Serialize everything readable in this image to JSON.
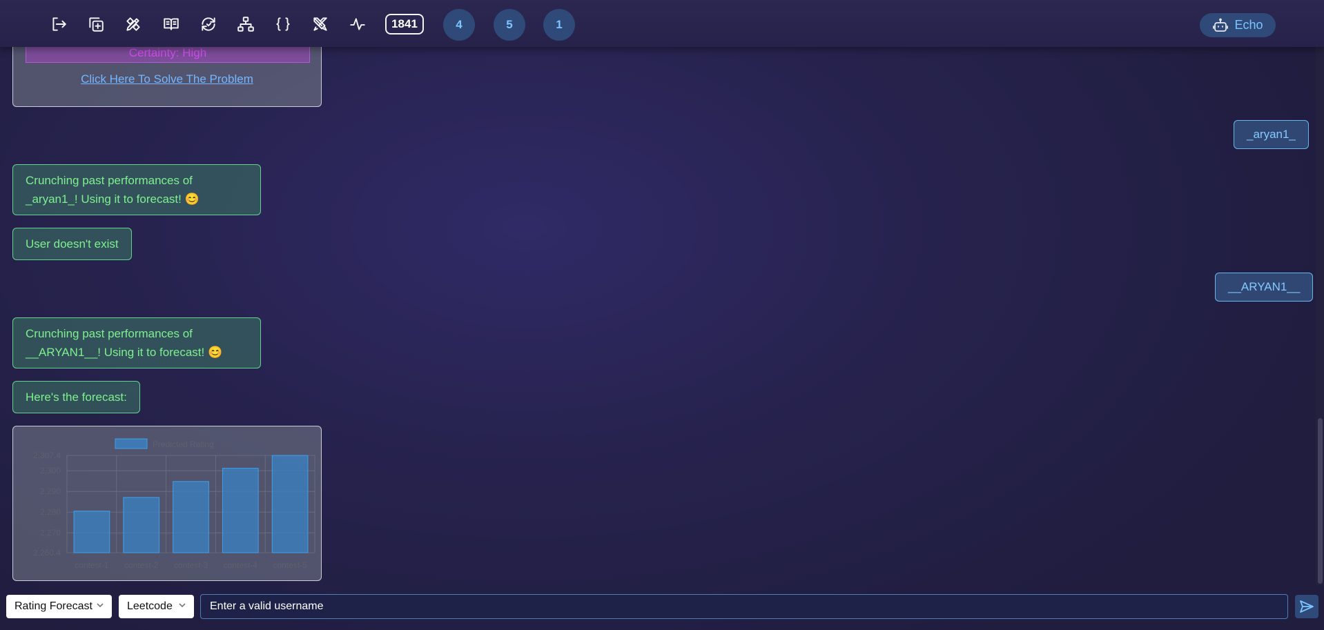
{
  "toolbar": {
    "icons": [
      "logout-icon",
      "copy-add-icon",
      "edit-ruler-icon",
      "book-open-icon",
      "refresh-icon",
      "sitemap-icon",
      "braces-icon",
      "swords-icon",
      "activity-icon"
    ],
    "count": "1841",
    "badges": [
      "4",
      "5",
      "1"
    ],
    "echo_label": "Echo"
  },
  "messages": {
    "problem_card": {
      "certainty": "Certainty: High",
      "link": "Click Here To Solve The Problem"
    },
    "user1": "_aryan1_",
    "bot1_line1": "Crunching past performances of",
    "bot1_line2": "_aryan1_! Using it to forecast! 😊",
    "bot2": "User doesn't exist",
    "user2": "__ARYAN1__",
    "bot3_line1": "Crunching past performances of",
    "bot3_line2": "__ARYAN1__! Using it to forecast! 😊",
    "bot4": "Here's the forecast:"
  },
  "chart_data": {
    "type": "bar",
    "categories": [
      "contest-1",
      "contest-2",
      "contest-3",
      "contest-4",
      "contest-5"
    ],
    "series": [
      {
        "name": "Predicted Rating",
        "values": [
          2280.5,
          2287.1,
          2294.8,
          2301.2,
          2307.4
        ]
      }
    ],
    "ylim": [
      2260.4,
      2307.4
    ],
    "yticks": [
      "2,307.4",
      "2,300",
      "2,290",
      "2,280",
      "2,270",
      "2,260.4"
    ],
    "ytick_values": [
      2307.4,
      2300,
      2290,
      2280,
      2270,
      2260.4
    ],
    "bar_color": "#3b82c4",
    "legend": "top",
    "grid": true
  },
  "bottom": {
    "select1": "Rating Forecast",
    "select2": "Leetcode",
    "input_placeholder": "Enter a valid username"
  }
}
